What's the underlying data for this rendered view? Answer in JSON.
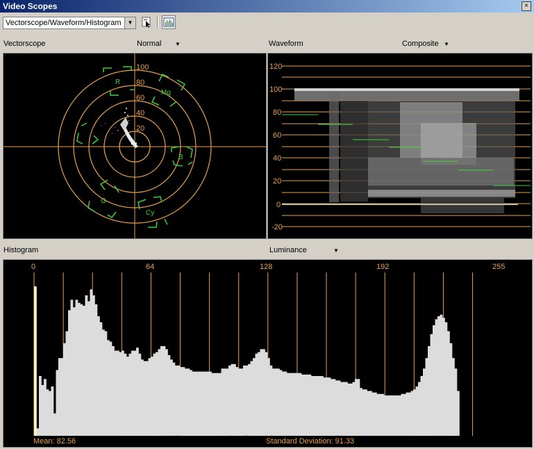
{
  "window": {
    "title": "Video Scopes",
    "close": "×"
  },
  "toolbar": {
    "layout_value": "Vectorscope/Waveform/Histogram"
  },
  "vectorscope": {
    "label": "Vectorscope",
    "mode": "Normal",
    "ring_labels": [
      "100",
      "80",
      "60",
      "40",
      "20"
    ],
    "targets": [
      "R",
      "Mg",
      "B",
      "Cy",
      "G",
      "Yl"
    ]
  },
  "waveform": {
    "label": "Waveform",
    "mode": "Composite",
    "ticks": [
      "120",
      "100",
      "80",
      "60",
      "40",
      "20",
      "0",
      "-20"
    ]
  },
  "histogram": {
    "label": "Histogram",
    "mode": "Luminance",
    "ticks": [
      "0",
      "64",
      "128",
      "192",
      "255"
    ],
    "mean": "Mean: 82.56",
    "std_dev": "Standard Deviation: 91.33"
  },
  "colors": {
    "accent": "#e8a04a",
    "target": "#3ad13a",
    "trace": "#e0e0e0"
  },
  "chart_data": {
    "type": "bar",
    "title": "Histogram",
    "xlim": [
      0,
      255
    ],
    "values": [
      100,
      5,
      40,
      34,
      38,
      31,
      30,
      33,
      15,
      44,
      52,
      52,
      62,
      70,
      84,
      91,
      86,
      91,
      89,
      88,
      87,
      94,
      90,
      98,
      94,
      88,
      80,
      76,
      71,
      70,
      64,
      63,
      60,
      57,
      57,
      56,
      57,
      55,
      53,
      55,
      57,
      57,
      59,
      55,
      51,
      50,
      50,
      52,
      53,
      55,
      56,
      58,
      60,
      60,
      58,
      54,
      51,
      49,
      47,
      47,
      46,
      46,
      45,
      45,
      44,
      43,
      43,
      43,
      43,
      43,
      43,
      43,
      43,
      42,
      42,
      42,
      42,
      45,
      45,
      45,
      47,
      48,
      48,
      46,
      45,
      45,
      47,
      47,
      48,
      50,
      52,
      55,
      56,
      58,
      58,
      56,
      52,
      47,
      45,
      45,
      45,
      44,
      43,
      43,
      42,
      42,
      42,
      42,
      42,
      42,
      41,
      41,
      41,
      41,
      40,
      40,
      40,
      40,
      40,
      39,
      39,
      39,
      38,
      38,
      37,
      37,
      36,
      36,
      36,
      35,
      35,
      36,
      38,
      38,
      32,
      31,
      31,
      30,
      30,
      29,
      29,
      28,
      28,
      28,
      27,
      27,
      27,
      27,
      27,
      27,
      27,
      28,
      28,
      29,
      29,
      30,
      31,
      33,
      36,
      40,
      45,
      52,
      60,
      68,
      74,
      78,
      80,
      81,
      79,
      76,
      70,
      62,
      52,
      45,
      30
    ]
  }
}
